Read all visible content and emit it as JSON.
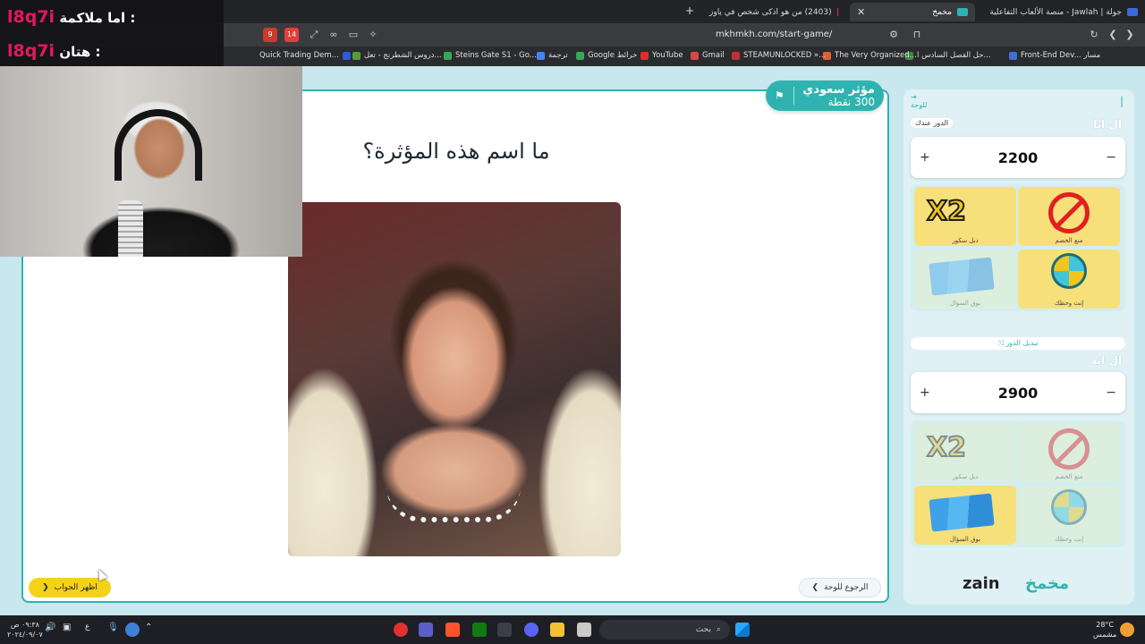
{
  "browser": {
    "tabs": [
      {
        "title": "جولة | Jawlah - منصة الألعاب التفاعلية",
        "active": false
      },
      {
        "title": "مخمخ",
        "active": true
      },
      {
        "title": "(2403) من هو اذكى شخص في ياوز",
        "active": false
      }
    ],
    "new_tab": "+",
    "url": "mkhmkh.com/start-game/",
    "bookmarks": [
      "Quick Trading Dem...",
      "دروس الشطرنج - تعل...",
      "Steins Gate S1 - Go...",
      "ترجمة",
      "Google خرائط",
      "YouTube",
      "Gmail",
      "STEAMUNLOCKED »...",
      "The Very Organized...",
      "حل الفصل السادس ا...",
      "Front-End Dev... مسار"
    ],
    "ext_badges": [
      "9",
      "14"
    ]
  },
  "game": {
    "category": "مؤثر سعودي",
    "points": "300 نقطة",
    "question": "ما اسم هذه المؤثرة؟",
    "back_button": "الرجوع للوحة",
    "show_answer_button": "اظهر الجواب"
  },
  "panel": {
    "board_link": "للوحة",
    "swap_turn": "تبديل الدور",
    "turn_label": "الدور عندك",
    "teams": [
      {
        "name": "ال انا",
        "score": "2200",
        "tools": [
          {
            "label": "منع الخصم",
            "icon": "block-icon",
            "used": false
          },
          {
            "label": "دبل سكور",
            "icon": "x2-icon",
            "used": false
          },
          {
            "label": "إنت وحظك",
            "icon": "wheel-icon",
            "used": false
          },
          {
            "label": "بوق السؤال",
            "icon": "cards-icon",
            "used": true
          }
        ]
      },
      {
        "name": "ال انه",
        "score": "2900",
        "tools": [
          {
            "label": "منع الخصم",
            "icon": "block-icon",
            "used": true
          },
          {
            "label": "دبل سكور",
            "icon": "x2-icon",
            "used": true
          },
          {
            "label": "إنت وحظك",
            "icon": "wheel-icon",
            "used": true
          },
          {
            "label": "بوق السؤال",
            "icon": "cards-icon",
            "used": false
          }
        ]
      }
    ],
    "plus": "+",
    "minus": "−",
    "brand_zain": "zain",
    "brand_site": "مخمخ"
  },
  "stream_overlay": {
    "line1_label": "اما ملاكمة :",
    "line1_handle": "l8q7i",
    "line2_label": "هتان :",
    "line2_handle": "l8q7i"
  },
  "taskbar": {
    "search_placeholder": "بحث",
    "time": "٠٩:٣٨ ص",
    "date": "٢٠٢٤/٠٩/٠٧",
    "weather_temp": "28°C",
    "weather_desc": "مشمس",
    "lang": "ع"
  },
  "colors": {
    "teal": "#2fb3b1",
    "yellow": "#f4d21a",
    "panel_bg": "#dff1f4"
  }
}
